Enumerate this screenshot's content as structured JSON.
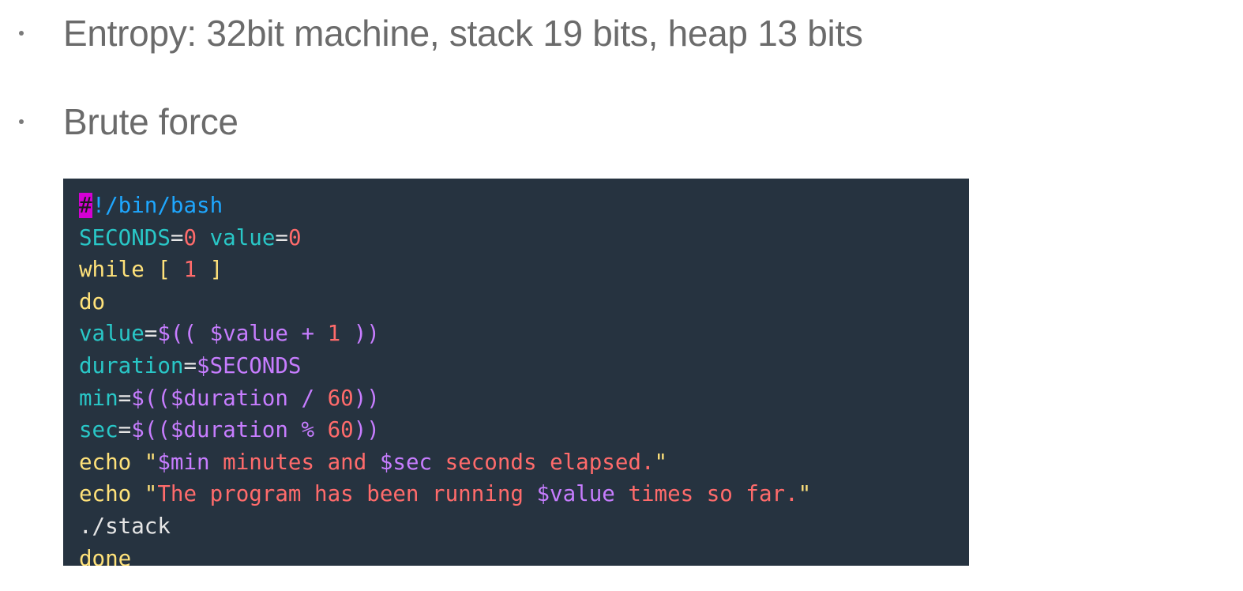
{
  "bullets": [
    {
      "text": "Entropy: 32bit machine, stack 19 bits, heap 13 bits"
    },
    {
      "text": "Brute force"
    }
  ],
  "code": {
    "language": "bash",
    "lines": [
      [
        {
          "t": "#",
          "c": "cursor"
        },
        {
          "t": "!/bin/bash",
          "c": "shebang"
        }
      ],
      [
        {
          "t": "SECONDS",
          "c": "var"
        },
        {
          "t": "=",
          "c": "op"
        },
        {
          "t": "0",
          "c": "num"
        },
        {
          "t": " ",
          "c": "plain"
        },
        {
          "t": "value",
          "c": "var"
        },
        {
          "t": "=",
          "c": "op"
        },
        {
          "t": "0",
          "c": "num"
        }
      ],
      [
        {
          "t": "while",
          "c": "kw"
        },
        {
          "t": " [ ",
          "c": "kw"
        },
        {
          "t": "1",
          "c": "num"
        },
        {
          "t": " ]",
          "c": "kw"
        }
      ],
      [
        {
          "t": "do",
          "c": "kw"
        }
      ],
      [
        {
          "t": "value",
          "c": "var"
        },
        {
          "t": "=",
          "c": "op"
        },
        {
          "t": "$(( $value + ",
          "c": "dollar"
        },
        {
          "t": "1",
          "c": "num"
        },
        {
          "t": " ))",
          "c": "dollar"
        }
      ],
      [
        {
          "t": "duration",
          "c": "var"
        },
        {
          "t": "=",
          "c": "op"
        },
        {
          "t": "$SECONDS",
          "c": "dollar"
        }
      ],
      [
        {
          "t": "min",
          "c": "var"
        },
        {
          "t": "=",
          "c": "op"
        },
        {
          "t": "$(($duration / ",
          "c": "dollar"
        },
        {
          "t": "60",
          "c": "num"
        },
        {
          "t": "))",
          "c": "dollar"
        }
      ],
      [
        {
          "t": "sec",
          "c": "var"
        },
        {
          "t": "=",
          "c": "op"
        },
        {
          "t": "$(($duration % ",
          "c": "dollar"
        },
        {
          "t": "60",
          "c": "num"
        },
        {
          "t": "))",
          "c": "dollar"
        }
      ],
      [
        {
          "t": "echo",
          "c": "kw"
        },
        {
          "t": " \"",
          "c": "kw"
        },
        {
          "t": "$min",
          "c": "dollar"
        },
        {
          "t": " minutes and ",
          "c": "str"
        },
        {
          "t": "$sec",
          "c": "dollar"
        },
        {
          "t": " seconds elapsed.",
          "c": "str"
        },
        {
          "t": "\"",
          "c": "kw"
        }
      ],
      [
        {
          "t": "echo",
          "c": "kw"
        },
        {
          "t": " \"",
          "c": "kw"
        },
        {
          "t": "The program has been running ",
          "c": "str"
        },
        {
          "t": "$value",
          "c": "dollar"
        },
        {
          "t": " times so far.",
          "c": "str"
        },
        {
          "t": "\"",
          "c": "kw"
        }
      ],
      [
        {
          "t": "./stack",
          "c": "plain"
        }
      ],
      [
        {
          "t": "done",
          "c": "kw"
        }
      ]
    ]
  },
  "colors": {
    "background": "#ffffff",
    "bullet_text": "#6b6b6b",
    "code_background": "#263340",
    "cursor": "#d400d4",
    "shebang": "#1ea7ff",
    "variable": "#29c7c7",
    "number": "#ff6b6b",
    "keyword": "#ffe27a",
    "expansion": "#c77dff",
    "string": "#ff6b6b"
  }
}
